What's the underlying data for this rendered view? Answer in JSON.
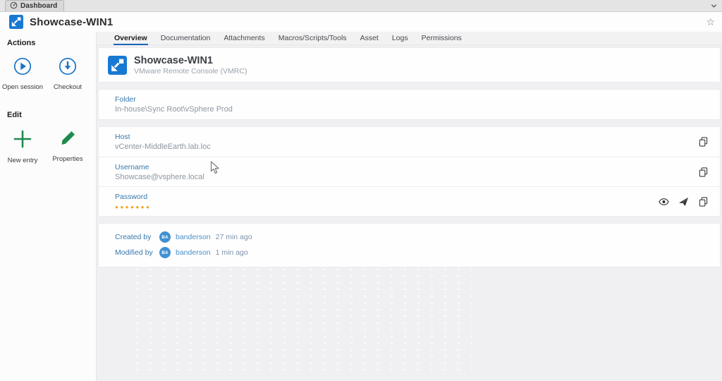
{
  "window": {
    "doc_tab_label": "Dashboard",
    "title": "Showcase-WIN1"
  },
  "sidebar": {
    "actions_heading": "Actions",
    "open_session_label": "Open session",
    "checkout_label": "Checkout",
    "edit_heading": "Edit",
    "new_entry_label": "New entry",
    "properties_label": "Properties"
  },
  "tabs": {
    "active": "Overview",
    "items": [
      "Overview",
      "Documentation",
      "Attachments",
      "Macros/Scripts/Tools",
      "Asset",
      "Logs",
      "Permissions"
    ]
  },
  "entry": {
    "name": "Showcase-WIN1",
    "type": "VMware Remote Console (VMRC)"
  },
  "fields": {
    "folder": {
      "label": "Folder",
      "value": "In-house\\Sync Root\\vSphere Prod"
    },
    "host": {
      "label": "Host",
      "value": "vCenter-MiddleEarth.lab.loc"
    },
    "username": {
      "label": "Username",
      "value": "Showcase@vsphere.local"
    },
    "password": {
      "label": "Password",
      "mask": "●●●●●●●"
    }
  },
  "meta": {
    "created": {
      "label": "Created by",
      "initials": "BA",
      "user": "banderson",
      "time": "27 min ago"
    },
    "modified": {
      "label": "Modified by",
      "initials": "BA",
      "user": "banderson",
      "time": "1 min ago"
    }
  },
  "icons": {
    "doc_tab": "dashboard-gauge-icon",
    "chevron": "chevron-down-icon",
    "favorite": "star-icon",
    "open_session": "play-circle-icon",
    "checkout": "download-circle-icon",
    "new_entry": "plus-icon",
    "properties": "pencil-icon",
    "copy": "copy-icon",
    "reveal": "eye-icon",
    "send": "paper-plane-icon",
    "entry_type": "vmrc-icon"
  },
  "colors": {
    "accent_blue": "#1673c6",
    "label_blue": "#3879ad",
    "link_blue": "#4a90c8",
    "avatar_blue": "#4190d2",
    "action_green": "#1e8a4c",
    "password_orange": "#f5a31f",
    "tab_underline": "#1a65b4"
  }
}
